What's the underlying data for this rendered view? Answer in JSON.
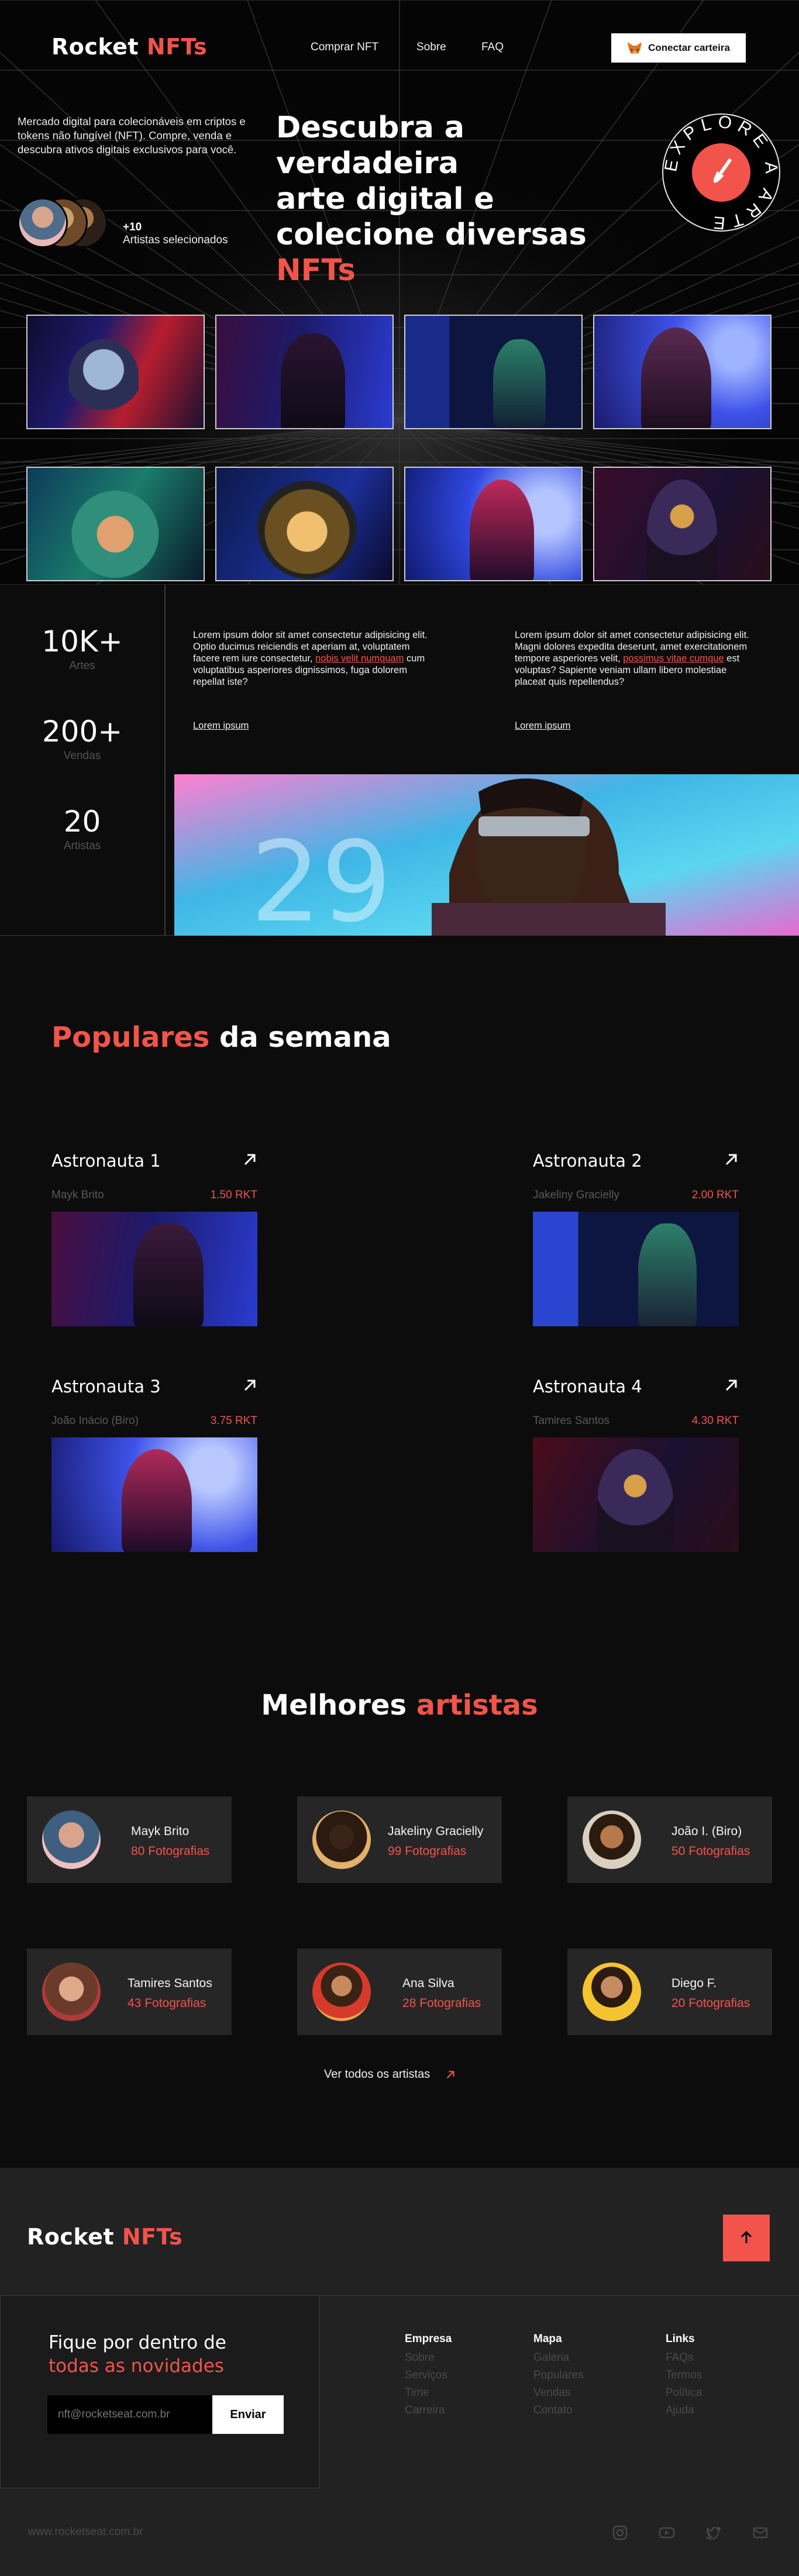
{
  "header": {
    "logo_main": "Rocket",
    "logo_accent": "NFTs",
    "nav": [
      "Comprar NFT",
      "Sobre",
      "FAQ"
    ],
    "wallet_button": "Conectar carteira"
  },
  "hero": {
    "intro": "Mercado digital para colecionáveis em criptos e tokens não fungível (NFT). Compre, venda e descubra ativos digitais exclusivos para você.",
    "artists_count": "+10",
    "artists_label": "Artistas selecionados",
    "title_1": "Descubra a verdadeira",
    "title_2": "arte digital e",
    "title_3": "colecione diversas",
    "title_accent": "NFTs",
    "badge_text": "EXPLORE A ARTE"
  },
  "stats": {
    "items": [
      {
        "value": "10K+",
        "label": "Artes"
      },
      {
        "value": "200+",
        "label": "Vendas"
      },
      {
        "value": "20",
        "label": "Artistas"
      }
    ],
    "col1": {
      "text_a": "Lorem ipsum dolor sit amet consectetur adipisicing elit. Optio ducimus reiciendis et aperiam at, voluptatem facere rem iure consectetur, ",
      "text_link": "nobis velit numquam",
      "text_b": " cum voluptatibus asperiores dignissimos, fuga dolorem repellat iste?",
      "link": "Lorem ipsum"
    },
    "col2": {
      "text_a": "Lorem ipsum dolor sit amet consectetur adipisicing elit. Magni dolores expedita deserunt, amet exercitationem tempore asperiores velit, ",
      "text_link": "possimus vitae cumque",
      "text_b": " est voluptas? Sapiente veniam ullam libero molestiae placeat quis repellendus?",
      "link": "Lorem ipsum"
    },
    "banner_sign": "29"
  },
  "populares": {
    "title_accent": "Populares",
    "title_rest": "da semana",
    "cards": [
      {
        "name": "Astronauta 1",
        "artist": "Mayk Brito",
        "price": "1.50 RKT"
      },
      {
        "name": "Astronauta 2",
        "artist": "Jakeliny Gracielly",
        "price": "2.00 RKT"
      },
      {
        "name": "Astronauta 3",
        "artist": "João Inácio (Biro)",
        "price": "3.75 RKT"
      },
      {
        "name": "Astronauta 4",
        "artist": "Tamires Santos",
        "price": "4.30 RKT"
      }
    ]
  },
  "artistas": {
    "title_main": "Melhores",
    "title_accent": "artistas",
    "cards": [
      {
        "name": "Mayk Brito",
        "count": "80 Fotografias"
      },
      {
        "name": "Jakeliny Gracielly",
        "count": "99 Fotografias"
      },
      {
        "name": "João I. (Biro)",
        "count": "50 Fotografias"
      },
      {
        "name": "Tamires Santos",
        "count": "43 Fotografias"
      },
      {
        "name": "Ana Silva",
        "count": "28 Fotografias"
      },
      {
        "name": "Diego F.",
        "count": "20 Fotografias"
      }
    ],
    "see_all": "Ver todos os artistas"
  },
  "footer": {
    "logo_main": "Rocket",
    "logo_accent": "NFTs",
    "news_title": "Fique por dentro de",
    "news_accent": "todas as novidades",
    "email_placeholder": "nft@rocketseat.com.br",
    "send_button": "Enviar",
    "columns": [
      {
        "title": "Empresa",
        "items": [
          "Sobre",
          "Serviços",
          "Time",
          "Carreira"
        ]
      },
      {
        "title": "Mapa",
        "items": [
          "Galeria",
          "Populares",
          "Vendas",
          "Contato"
        ]
      },
      {
        "title": "Links",
        "items": [
          "FAQs",
          "Termos",
          "Política",
          "Ajuda"
        ]
      }
    ],
    "url": "www.rocketseat.com.br",
    "socials": [
      "instagram-icon",
      "youtube-icon",
      "twitter-icon",
      "mail-icon"
    ]
  },
  "colors": {
    "accent": "#f2544b",
    "background": "#0c0c0c",
    "card": "#262626",
    "footer": "#222222"
  }
}
